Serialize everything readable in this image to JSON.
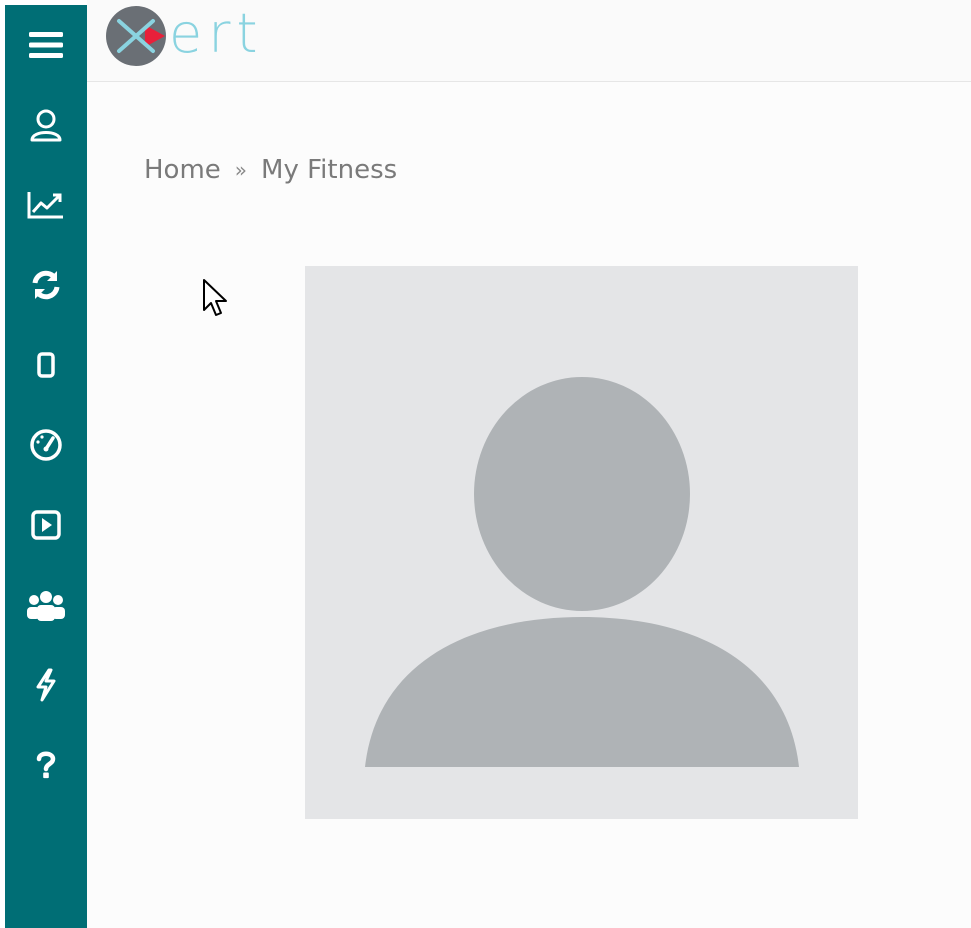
{
  "app": {
    "logo_text": "ert",
    "colors": {
      "sidebar": "#006e75",
      "logo_text": "#8ad3e0",
      "logo_accent": "#e8203a",
      "logo_circle": "#6a6f75"
    }
  },
  "sidebar": {
    "items": [
      {
        "icon": "menu-icon"
      },
      {
        "icon": "user-icon"
      },
      {
        "icon": "chart-line-icon"
      },
      {
        "icon": "sync-icon"
      },
      {
        "icon": "mobile-icon"
      },
      {
        "icon": "speedometer-icon"
      },
      {
        "icon": "play-square-icon"
      },
      {
        "icon": "users-group-icon"
      },
      {
        "icon": "lightning-icon"
      },
      {
        "icon": "question-icon"
      }
    ]
  },
  "breadcrumb": {
    "home": "Home",
    "separator": "»",
    "current": "My Fitness"
  },
  "avatar": {
    "icon": "default-avatar-icon"
  }
}
